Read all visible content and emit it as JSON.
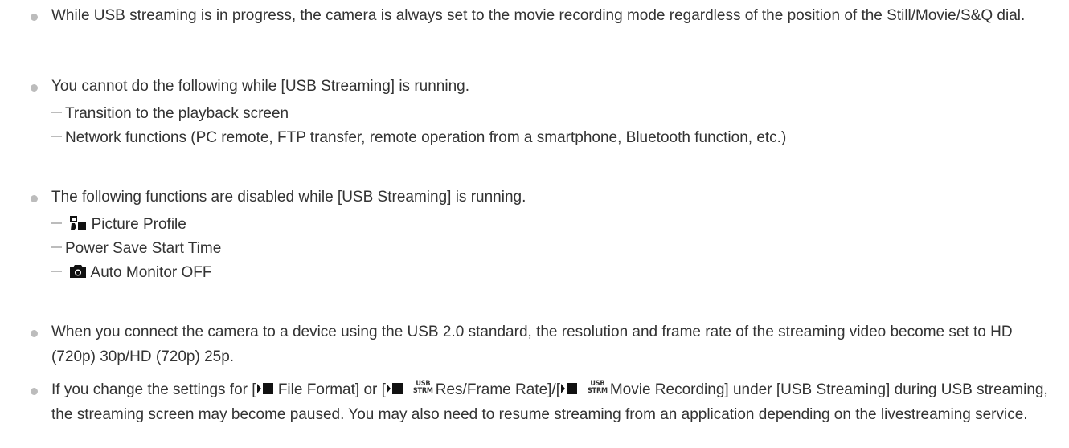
{
  "notes": [
    {
      "text": "While USB streaming is in progress, the camera is always set to the movie recording mode regardless of the position of the Still/Movie/S&Q dial."
    },
    {
      "text": "You cannot do the following while [USB Streaming] is running.",
      "items": [
        "Transition to the playback screen",
        "Network functions (PC remote, FTP transfer, remote operation from a smartphone, Bluetooth function, etc.)"
      ]
    },
    {
      "text": "The following functions are disabled while [USB Streaming] is running.",
      "items": [
        {
          "icon": "picture-profile-icon",
          "label": "Picture Profile"
        },
        {
          "label": "Power Save Start Time"
        },
        {
          "icon": "camera-icon",
          "label": "Auto Monitor OFF"
        }
      ]
    },
    {
      "text": "When you connect the camera to a device using the USB 2.0 standard, the resolution and frame rate of the streaming video become set to HD (720p) 30p/HD (720p) 25p."
    },
    {
      "parts": {
        "p1": "If you change the settings for [",
        "p2": "File Format] or [",
        "p3": "Res/Frame Rate]/[",
        "p4": "Movie Recording] under [USB Streaming]",
        "p5": "during USB streaming, the streaming screen may become paused. You may also need to resume streaming from an application depending on the livestreaming service."
      },
      "usb_badge_top": "USB",
      "usb_badge_bottom": "STRM"
    }
  ]
}
